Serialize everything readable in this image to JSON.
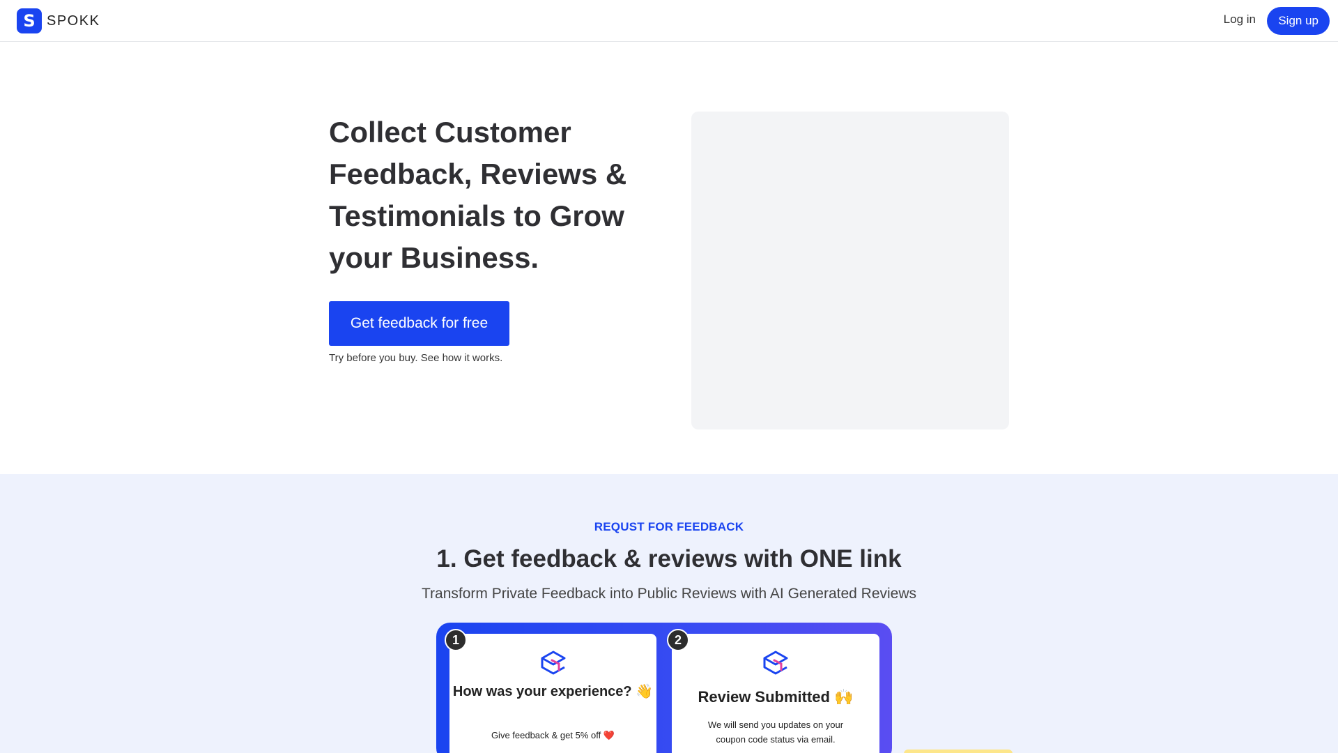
{
  "brand": {
    "logo_letter": "S",
    "name": "SPOKK",
    "color": "#1a44f0"
  },
  "nav": {
    "login": "Log in",
    "signup": "Sign up"
  },
  "hero": {
    "title": "Collect Customer Feedback, Reviews & Testimonials to Grow your Business.",
    "cta": "Get feedback for free",
    "subtext": "Try before you buy. See how it works."
  },
  "section": {
    "eyebrow": "REQUST FOR FEEDBACK",
    "title": "1. Get feedback & reviews with ONE link",
    "subtitle": "Transform Private Feedback into Public Reviews with AI Generated Reviews"
  },
  "steps": [
    {
      "number": "1",
      "title": "How was your experience? 👋",
      "note": "Give feedback & get 5% off ❤️",
      "icon": "spokk-mark-icon"
    },
    {
      "number": "2",
      "title": "Review Submitted 🙌",
      "note": "We will send you updates on your coupon code status via email.",
      "icon": "spokk-mark-icon"
    }
  ]
}
